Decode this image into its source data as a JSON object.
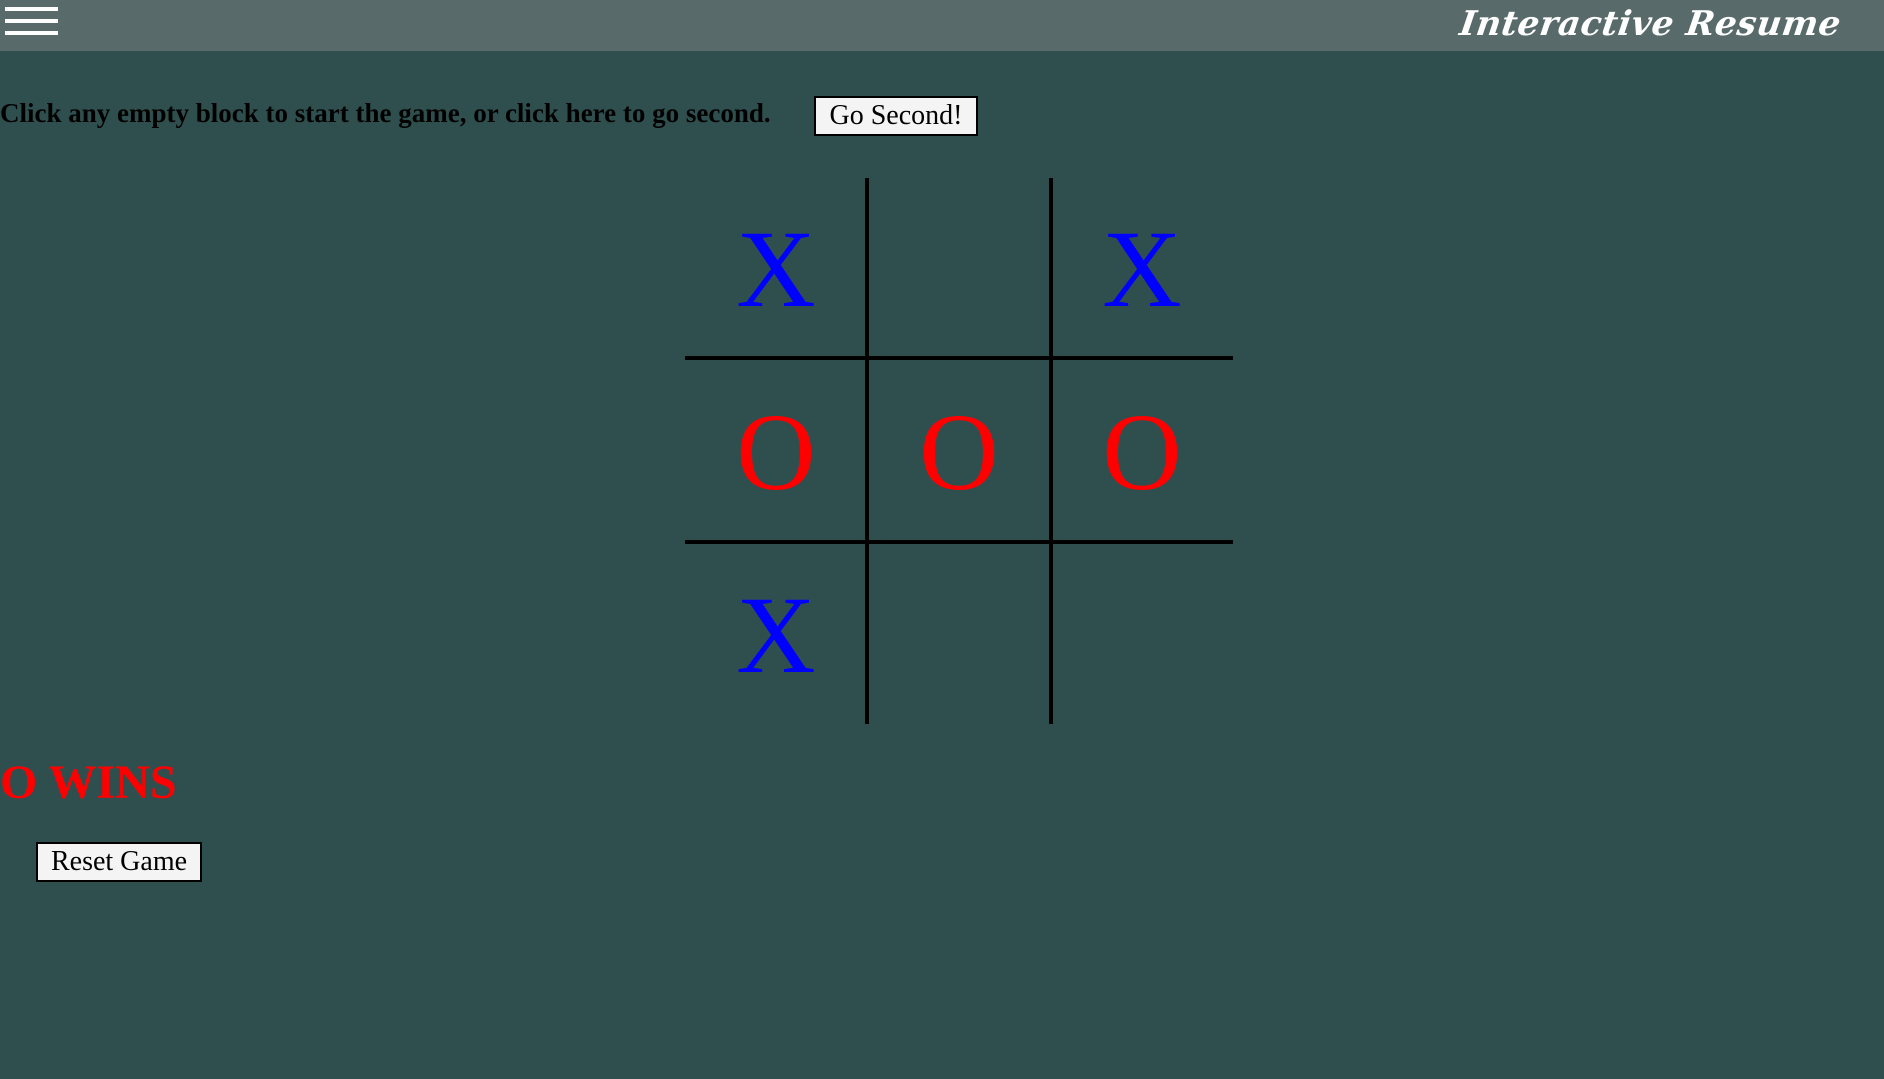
{
  "header": {
    "menu_icon": "hamburger-menu-icon",
    "brand": "Interactive Resume"
  },
  "game": {
    "intro_text": "Click any empty block to start the game, or click here to go second.",
    "go_second_label": "Go Second!",
    "board": [
      [
        "X",
        "",
        "X"
      ],
      [
        "O",
        "O",
        "O"
      ],
      [
        "X",
        "",
        ""
      ]
    ],
    "result_text": "O WINS",
    "reset_label": "Reset Game"
  },
  "colors": {
    "background": "#2f4f4f",
    "topbar": "#586a6a",
    "x_mark": "#0000ff",
    "o_mark": "#ff0000",
    "result": "#ff0000"
  }
}
